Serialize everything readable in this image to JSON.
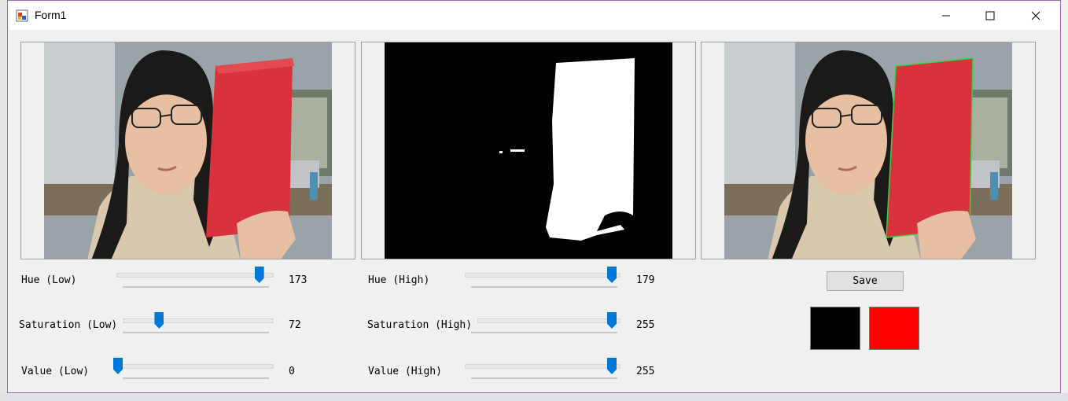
{
  "window": {
    "title": "Form1"
  },
  "panels": [
    {
      "name": "original-image"
    },
    {
      "name": "mask-image"
    },
    {
      "name": "result-image"
    }
  ],
  "sliders": [
    {
      "label": "Hue (Low)",
      "value": "173",
      "fraction": 0.966
    },
    {
      "label": "Saturation (Low)",
      "value": "72",
      "fraction": 0.282
    },
    {
      "label": "Value (Low)",
      "value": "0",
      "fraction": 0.0
    },
    {
      "label": "Hue (High)",
      "value": "179",
      "fraction": 1.0
    },
    {
      "label": "Saturation (High)",
      "value": "255",
      "fraction": 1.0
    },
    {
      "label": "Value (High)",
      "value": "255",
      "fraction": 1.0
    }
  ],
  "save_button": {
    "label": "Save"
  },
  "swatches": {
    "low_color": "#000000",
    "high_color": "#ff0000"
  },
  "colors": {
    "slider_thumb": "#0078d7",
    "title_border": "#9b6aa8"
  }
}
